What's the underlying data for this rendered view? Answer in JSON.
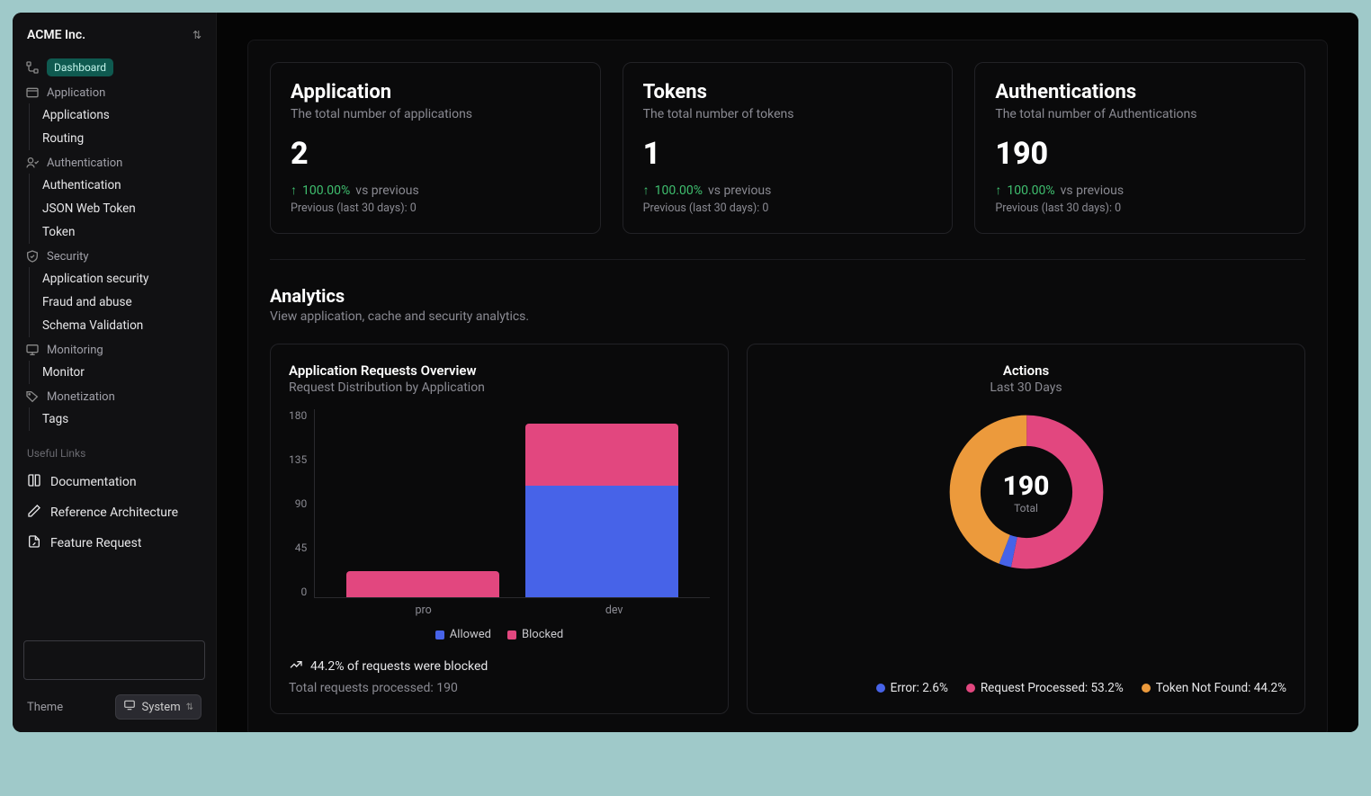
{
  "org": {
    "name": "ACME Inc."
  },
  "sidebar": {
    "dashboard": "Dashboard",
    "sections": {
      "application": {
        "label": "Application",
        "items": [
          "Applications",
          "Routing"
        ]
      },
      "authentication": {
        "label": "Authentication",
        "items": [
          "Authentication",
          "JSON Web Token",
          "Token"
        ]
      },
      "security": {
        "label": "Security",
        "items": [
          "Application security",
          "Fraud and abuse",
          "Schema Validation"
        ]
      },
      "monitoring": {
        "label": "Monitoring",
        "items": [
          "Monitor"
        ]
      },
      "monetization": {
        "label": "Monetization",
        "items": [
          "Tags"
        ]
      }
    },
    "links_header": "Useful Links",
    "links": {
      "docs": "Documentation",
      "refarch": "Reference Architecture",
      "featreq": "Feature Request"
    }
  },
  "theme": {
    "label": "Theme",
    "value": "System"
  },
  "stats": {
    "application": {
      "title": "Application",
      "subtitle": "The total number of applications",
      "value": "2",
      "change": "100.00%",
      "vs": "vs previous",
      "previous": "Previous (last 30 days): 0"
    },
    "tokens": {
      "title": "Tokens",
      "subtitle": "The total number of tokens",
      "value": "1",
      "change": "100.00%",
      "vs": "vs previous",
      "previous": "Previous (last 30 days): 0"
    },
    "auth": {
      "title": "Authentications",
      "subtitle": "The total number of Authentications",
      "value": "190",
      "change": "100.00%",
      "vs": "vs previous",
      "previous": "Previous (last 30 days): 0"
    }
  },
  "analytics": {
    "title": "Analytics",
    "subtitle": "View application, cache and security analytics."
  },
  "bar_chart": {
    "title": "Application Requests Overview",
    "subtitle": "Request Distribution by Application",
    "legend": {
      "allowed": "Allowed",
      "blocked": "Blocked"
    },
    "footer": "44.2% of requests were blocked",
    "footer_sub": "Total requests processed: 190",
    "x": {
      "pro": "pro",
      "dev": "dev"
    }
  },
  "pie_chart": {
    "title": "Actions",
    "subtitle": "Last 30 Days",
    "center_value": "190",
    "center_label": "Total",
    "legend": {
      "error": "Error: 2.6%",
      "processed": "Request Processed: 53.2%",
      "notfound": "Token Not Found: 44.2%"
    }
  },
  "chart_data": [
    {
      "type": "bar",
      "title": "Application Requests Overview",
      "subtitle": "Request Distribution by Application",
      "categories": [
        "pro",
        "dev"
      ],
      "series": [
        {
          "name": "Allowed",
          "values": [
            0,
            106
          ],
          "color": "#4763e8"
        },
        {
          "name": "Blocked",
          "values": [
            25,
            59
          ],
          "color": "#e2477f"
        }
      ],
      "ylim": [
        0,
        180
      ],
      "yticks": [
        0,
        45,
        90,
        135,
        180
      ],
      "stacked": true,
      "footer": "44.2% of requests were blocked",
      "total_processed": 190
    },
    {
      "type": "pie",
      "title": "Actions",
      "subtitle": "Last 30 Days",
      "total": 190,
      "series": [
        {
          "name": "Error",
          "value": 2.6,
          "color": "#4763e8"
        },
        {
          "name": "Request Processed",
          "value": 53.2,
          "color": "#e2477f"
        },
        {
          "name": "Token Not Found",
          "value": 44.2,
          "color": "#ec9a3c"
        }
      ]
    }
  ]
}
